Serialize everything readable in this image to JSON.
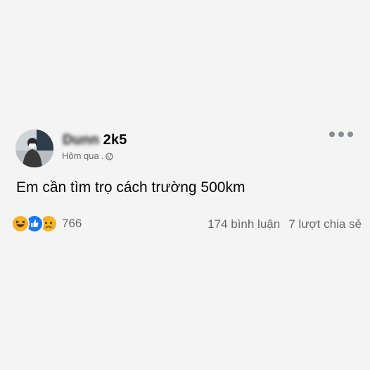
{
  "post": {
    "author_blurred": "Dunn ",
    "author_visible": "2k5",
    "timestamp": "Hôm qua",
    "separator": " .",
    "privacy_icon": "globe-icon",
    "text": "Em cần tìm trọ cách trường 500km",
    "more_icon": "more-horizontal-icon"
  },
  "engagement": {
    "reaction_icons": [
      "haha-icon",
      "like-icon",
      "sad-icon"
    ],
    "reaction_count": "766",
    "comments": "174 bình luận",
    "shares": "7 lượt chia sẻ"
  },
  "colors": {
    "background": "#f4f4f4",
    "secondary_text": "#65676b",
    "like_blue": "#1877f2",
    "emoji_yellow": "#f7b125"
  }
}
